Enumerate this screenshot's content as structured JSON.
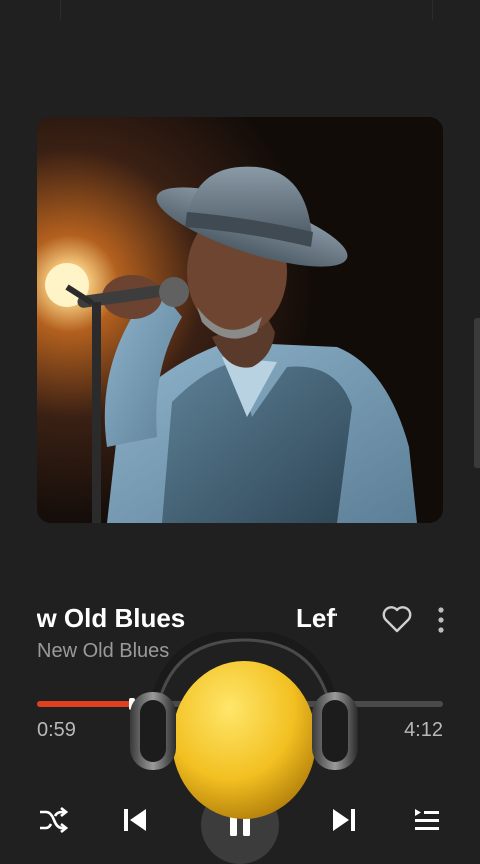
{
  "track": {
    "title_segments": [
      "ew Old Blues",
      "Left M"
    ],
    "artist": "New Old Blues",
    "liked": false
  },
  "playback": {
    "current_time": "0:59",
    "total_time": "4:12",
    "progress_fraction": 0.234,
    "state": "playing"
  },
  "icons": {
    "like": "heart-outline-icon",
    "more": "more-vertical-icon",
    "shuffle": "shuffle-icon",
    "previous": "skip-previous-icon",
    "pause": "pause-icon",
    "next": "skip-next-icon",
    "queue": "queue-list-icon",
    "overlay": "headphones-mascot-icon"
  },
  "colors": {
    "background": "#202020",
    "accent": "#e0401f",
    "secondary_text": "#9a9a9a",
    "mascot": "#f2c021"
  }
}
